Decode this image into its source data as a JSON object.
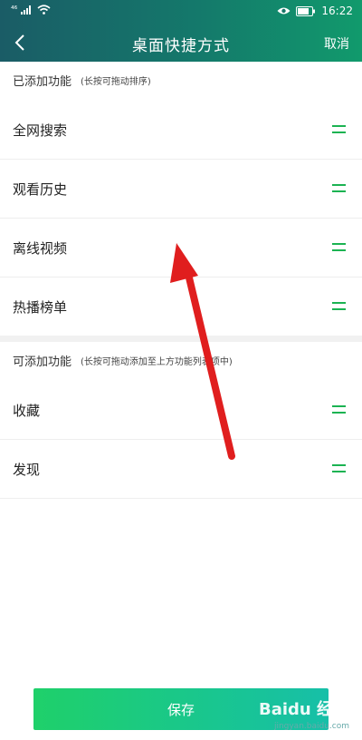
{
  "status_bar": {
    "signal": "⁴⁶",
    "time": "16:22"
  },
  "nav": {
    "title": "桌面快捷方式",
    "cancel_label": "取消"
  },
  "added_section": {
    "title": "已添加功能",
    "hint": "(长按可拖动排序)",
    "items": [
      {
        "label": "全网搜索"
      },
      {
        "label": "观看历史"
      },
      {
        "label": "离线视频"
      },
      {
        "label": "热播榜单"
      }
    ]
  },
  "available_section": {
    "title": "可添加功能",
    "hint": "(长按可拖动添加至上方功能列表项中)",
    "items": [
      {
        "label": "收藏"
      },
      {
        "label": "发现"
      }
    ]
  },
  "save_label": "保存",
  "watermark": {
    "brand": "Baidu 经验",
    "url": "jingyan.baidu.com"
  },
  "colors": {
    "header_gradient_start": "#1a5c66",
    "header_gradient_end": "#119a6c",
    "accent_green": "#1bb352",
    "arrow_red": "#e01e1e"
  },
  "icons": [
    "back-arrow-icon",
    "wifi-icon",
    "signal-icon",
    "eye-icon",
    "battery-icon",
    "drag-handle-icon"
  ]
}
